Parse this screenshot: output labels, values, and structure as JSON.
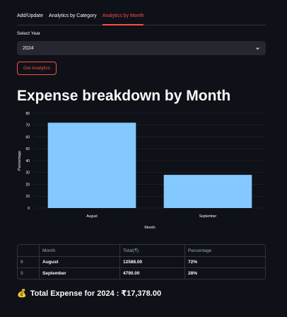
{
  "tabs": [
    {
      "label": "Add/Update"
    },
    {
      "label": "Analytics by Category"
    },
    {
      "label": "Analytics by Month"
    }
  ],
  "year_select": {
    "label": "Select Year",
    "value": "2024"
  },
  "get_button": {
    "label": "Get Analytics"
  },
  "heading": "Expense breakdown by Month",
  "colors": {
    "accent": "#ff4b4b",
    "bar": "#83c9ff",
    "background": "#0e1117"
  },
  "chart_data": {
    "type": "bar",
    "categories": [
      "August",
      "September"
    ],
    "values": [
      72,
      28
    ],
    "xlabel": "Month",
    "ylabel": "Percentage",
    "ylim": [
      0,
      80
    ],
    "yticks": [
      0,
      10,
      20,
      30,
      40,
      50,
      60,
      70,
      80
    ],
    "grid": true
  },
  "table": {
    "headers": [
      "",
      "Month",
      "Total(₹)",
      "Percentage"
    ],
    "rows": [
      [
        "8",
        "August",
        "12588.00",
        "72%"
      ],
      [
        "9",
        "September",
        "4790.00",
        "28%"
      ]
    ]
  },
  "total": {
    "icon": "money-bag-icon",
    "text": "Total Expense for 2024 : ₹17,378.00"
  }
}
